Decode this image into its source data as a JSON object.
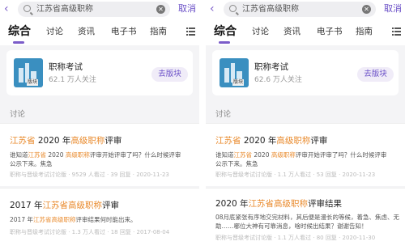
{
  "colors": {
    "accent": "#6a4fc7",
    "highlight": "#e98a2c",
    "book_cover": "#3a8fc0"
  },
  "panels": [
    {
      "search": {
        "query": "江苏省高级职称",
        "cancel_label": "取消"
      },
      "tabs": [
        "综合",
        "讨论",
        "资讯",
        "电子书",
        "指南"
      ],
      "card": {
        "title": "职称考试",
        "followers": "62.1 万人关注",
        "button": "去版块",
        "badge": "版块"
      },
      "section": "讨论",
      "articles": [
        {
          "title_parts": [
            "江苏省",
            " 2020 年",
            "高级职称",
            "评审"
          ],
          "snippet_parts": [
            "谁知道",
            "江苏省",
            " 2020 ",
            "高级职称",
            "评审开始评审了吗？什么时候评审",
            "公示下来。焦急"
          ],
          "meta": "职称与晋级考试讨论版 · 9529 人看过 · 39 回复 · 2020-11-23"
        },
        {
          "title_parts": [
            "2017 年",
            "江苏省高级职称",
            "评审"
          ],
          "snippet_parts": [
            "2017 年",
            "江苏省高级职称",
            "评审结果何时能出来。"
          ],
          "meta": "职称与晋级考试讨论版 · 1.3 万人看过 · 18 回复 · 2017-08-04"
        }
      ]
    },
    {
      "search": {
        "query": "江苏省高级职称",
        "cancel_label": "取消"
      },
      "tabs": [
        "综合",
        "讨论",
        "资讯",
        "电子书",
        "指南"
      ],
      "card": {
        "title": "职称考试",
        "followers": "62.6 万人关注",
        "button": "去版块",
        "badge": "版块"
      },
      "section": "讨论",
      "articles": [
        {
          "title_parts": [
            "江苏省",
            " 2020 年",
            "高级职称",
            "评审"
          ],
          "snippet_parts": [
            "谁知道",
            "江苏省",
            " 2020 ",
            "高级职称",
            "评审开始评审了吗？什么时候评审",
            "公示下来。焦急"
          ],
          "meta": "职称与晋级考试讨论版 · 1.1 万人看过 · 53 回复 · 2020-11-23"
        },
        {
          "title_parts": [
            "2020 年",
            "江苏省高级职称",
            "评审结果"
          ],
          "snippet_parts": [
            "08月底紧张有序地交完材料，其后便是漫长的等候，着急、焦虑、无",
            "助……哪位大神有可靠消息，啥时候出结果？谢谢告知！"
          ],
          "meta": "职称与晋级考试讨论版 · 1.1 万人看过 · 80 回复 · 2020-11-30"
        }
      ]
    }
  ]
}
